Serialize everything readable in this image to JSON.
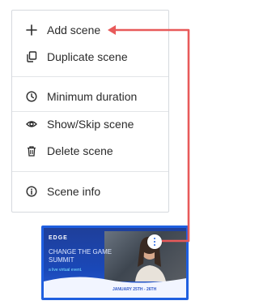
{
  "menu": {
    "items": [
      {
        "label": "Add scene",
        "icon": "plus-icon"
      },
      {
        "label": "Duplicate scene",
        "icon": "duplicate-icon"
      },
      {
        "label": "Minimum duration",
        "icon": "clock-icon"
      },
      {
        "label": "Show/Skip scene",
        "icon": "eye-icon"
      },
      {
        "label": "Delete scene",
        "icon": "trash-icon"
      },
      {
        "label": "Scene info",
        "icon": "info-icon"
      }
    ]
  },
  "thumbnail": {
    "brand": "EDGE",
    "title_line1": "CHANGE THE GAME",
    "title_line2": "SUMMIT",
    "subtitle": "a live virtual event.",
    "date": "JANUARY 25TH - 26TH",
    "more_icon": "kebab-menu-icon"
  },
  "colors": {
    "arrow": "#e85a5a",
    "thumbnail_border": "#1f5fe0",
    "menu_border": "#d6d9de",
    "separator": "#e3e5e8"
  }
}
